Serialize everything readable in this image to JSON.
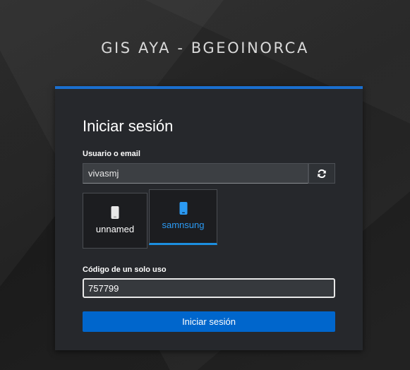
{
  "header": {
    "title": "GIS AYA - BGEOINORCA"
  },
  "login": {
    "heading": "Iniciar sesión",
    "username_label": "Usuario o email",
    "username_value": "vivasmj",
    "restart_icon": "refresh-icon",
    "devices": [
      {
        "label": "unnamed",
        "icon": "mobile-phone-icon",
        "selected": false
      },
      {
        "label": "samnsung",
        "icon": "mobile-phone-icon",
        "selected": true
      }
    ],
    "otp_label": "Código de un solo uso",
    "otp_value": "757799",
    "submit_label": "Iniciar sesión"
  },
  "colors": {
    "accent": "#0066cc",
    "card_border_top": "#1a6fcf",
    "selected_device": "#2b9af3",
    "card_background": "#26282c"
  }
}
